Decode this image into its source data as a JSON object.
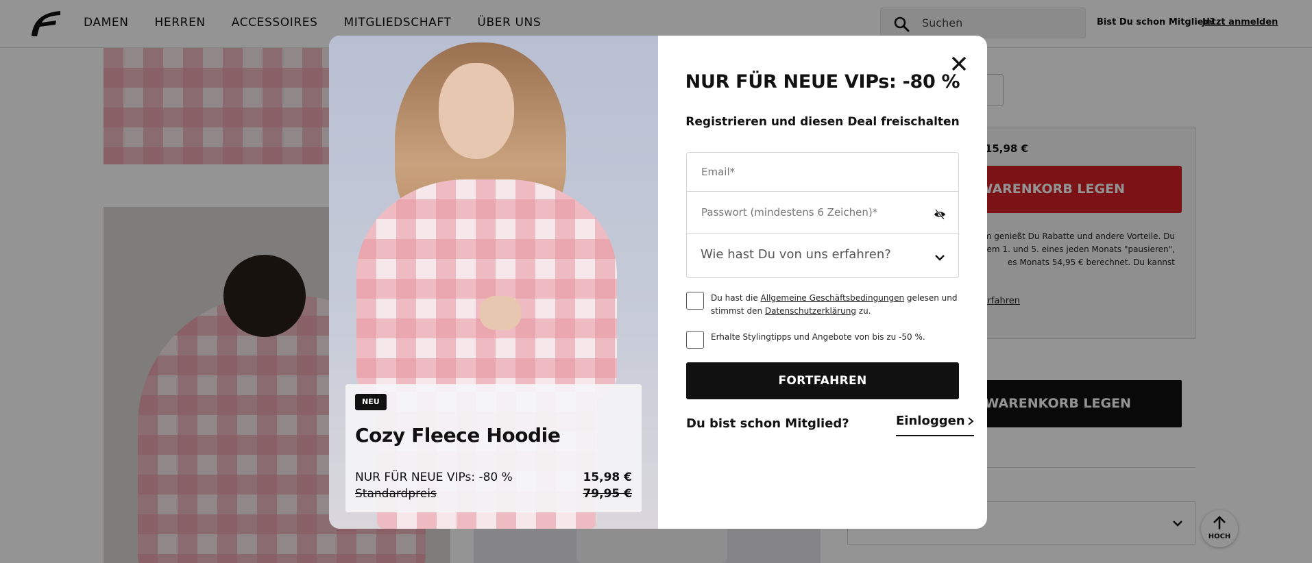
{
  "header": {
    "nav": [
      "DAMEN",
      "HERREN",
      "ACCESSOIRES",
      "MITGLIEDSCHAFT",
      "ÜBER UNS"
    ],
    "search_placeholder": "Suchen",
    "member_question": "Bist Du schon Mitglied?",
    "member_link": "Jetzt anmelden"
  },
  "background": {
    "vip_price": ": 15,98 €",
    "vip_cart_label": "DEN WARENKORB LEGEN",
    "vip_text_lines": [
      "m genießt Du Rabatte und andere Vorteile. Du",
      "em 1. und 5. eines jeden Monats \"pausieren\",",
      "es Monats 54,95 € berechnet. Du kannst"
    ],
    "vip_more_link": "aft erfahren",
    "std_cart_label": "DEN WARENKORB LEGEN",
    "scroll_top_label": "HOCH"
  },
  "modal": {
    "title": "NUR FÜR NEUE VIPs: -80 %",
    "subtitle": "Registrieren und diesen Deal freischalten",
    "email_placeholder": "Email*",
    "password_placeholder": "Passwort (mindestens 6 Zeichen)*",
    "referral_select": "Wie hast Du von uns erfahren?",
    "terms_pre": "Du hast die ",
    "terms_link": "Allgemeine Geschäftsbedingungen",
    "terms_mid": " gelesen und stimmst den ",
    "privacy_link": "Datenschutzerklärung",
    "terms_post": " zu.",
    "newsletter_text": "Erhalte Stylingtipps und Angebote von bis zu -50 %.",
    "continue_button": "FORTFAHREN",
    "already_member": "Du bist schon Mitglied?",
    "login_link": "Einloggen",
    "product": {
      "badge": "NEU",
      "name": "Cozy Fleece Hoodie",
      "vip_label": "NUR FÜR NEUE VIPs: -80 %",
      "vip_price": "15,98 €",
      "standard_label": "Standardpreis",
      "standard_price": "79,95 €"
    }
  },
  "colors": {
    "accent_red": "#d41f25",
    "primary_black": "#111111",
    "overlay": "rgba(0,0,0,0.42)"
  },
  "icons": [
    "brand-logo",
    "search-icon",
    "close-icon",
    "eye-off-icon",
    "chevron-down-icon",
    "chevron-right-icon",
    "arrow-up-icon"
  ]
}
